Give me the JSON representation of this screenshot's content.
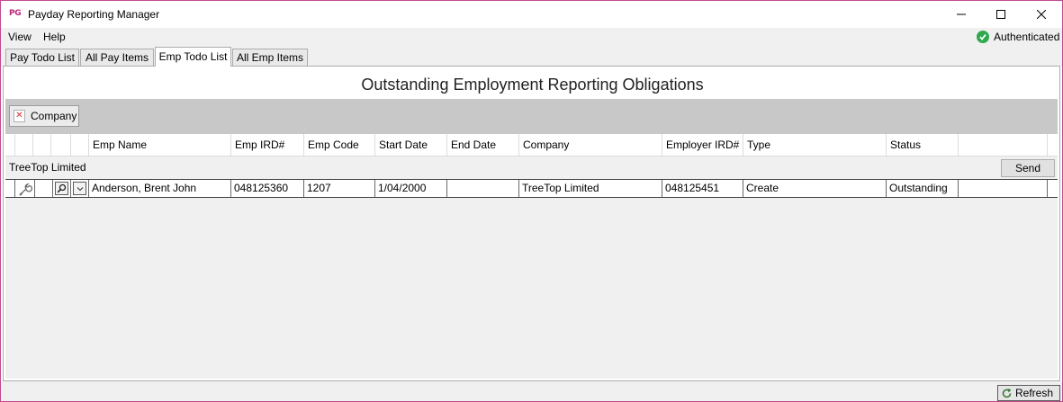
{
  "window": {
    "logo_text": "PG",
    "title": "Payday Reporting Manager",
    "accent_color": "#c0247a"
  },
  "menu": {
    "items": [
      "View",
      "Help"
    ]
  },
  "auth": {
    "status": "Authenticated",
    "icon": "check-circle-icon",
    "color": "#2fa84f"
  },
  "tabs": [
    {
      "label": "Pay Todo List",
      "active": false
    },
    {
      "label": "All Pay Items",
      "active": false
    },
    {
      "label": "Emp Todo List",
      "active": true
    },
    {
      "label": "All Emp Items",
      "active": false
    }
  ],
  "page": {
    "title": "Outstanding Employment Reporting Obligations"
  },
  "grouping": {
    "chip_label": "Company",
    "remove_icon": "close-icon"
  },
  "grid": {
    "columns": [
      "Emp Name",
      "Emp IRD#",
      "Emp Code",
      "Start Date",
      "End Date",
      "Company",
      "Employer IRD#",
      "Type",
      "Status"
    ],
    "group": {
      "title": "TreeTop Limited",
      "send_label": "Send"
    },
    "rows": [
      {
        "emp_name": "Anderson, Brent John",
        "emp_ird": "048125360",
        "emp_code": "1207",
        "start_date": "1/04/2000",
        "end_date": "",
        "company": "TreeTop Limited",
        "employer_ird": "048125451",
        "type": "Create",
        "status": "Outstanding"
      }
    ]
  },
  "statusbar": {
    "refresh_label": "Refresh",
    "refresh_icon": "refresh-icon"
  }
}
